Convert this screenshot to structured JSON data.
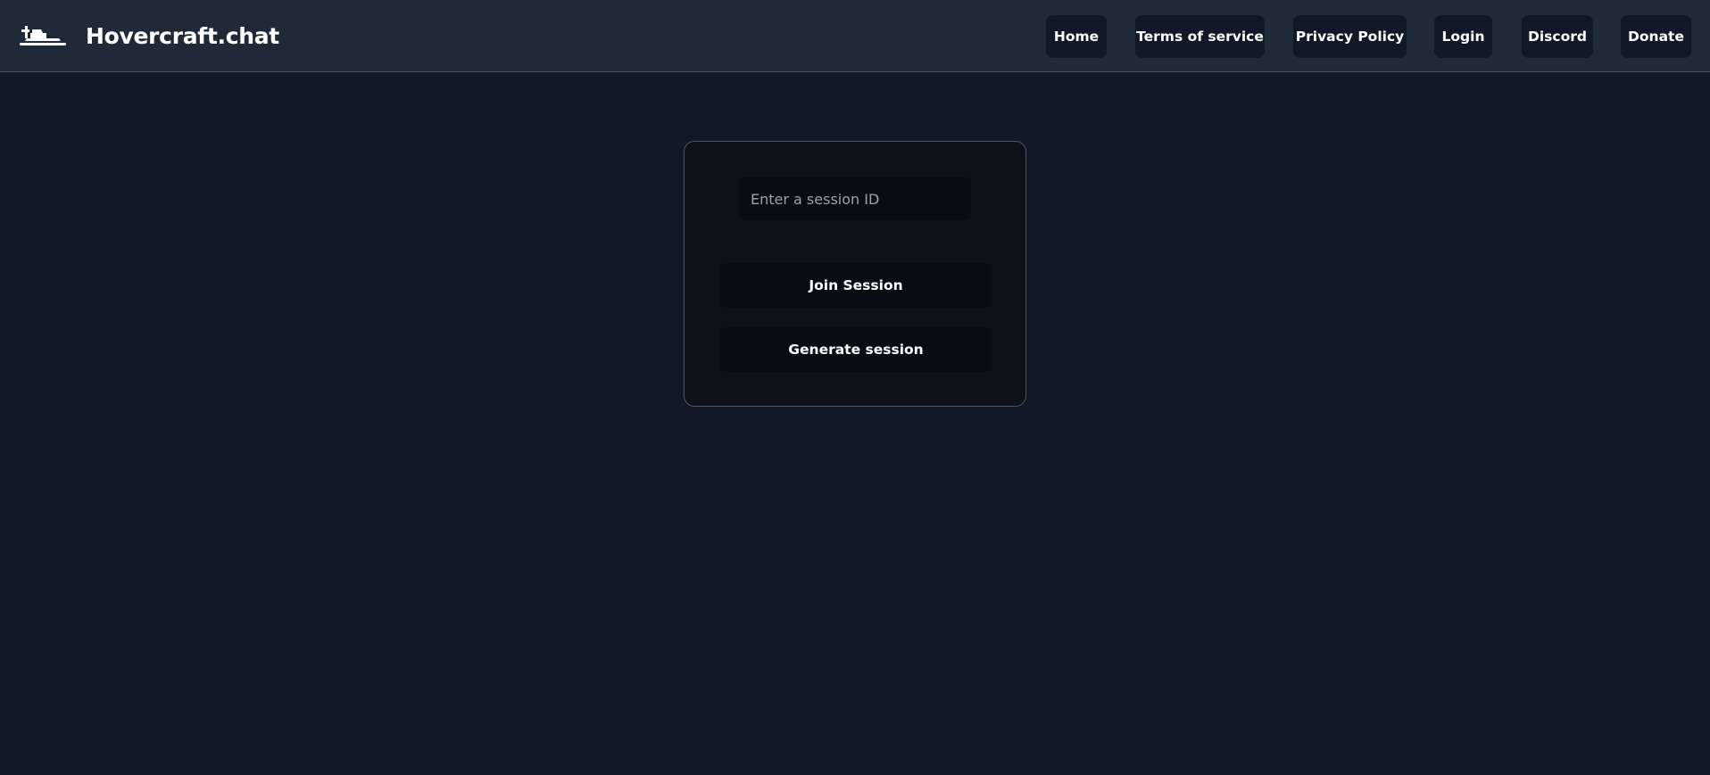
{
  "header": {
    "brand_title": "Hovercraft.chat",
    "brand_icon": "hovercraft-icon",
    "nav": [
      {
        "id": "home",
        "label": "Home"
      },
      {
        "id": "terms",
        "label": "Terms of service"
      },
      {
        "id": "privacy",
        "label": "Privacy Policy"
      },
      {
        "id": "login",
        "label": "Login"
      },
      {
        "id": "discord",
        "label": "Discord"
      },
      {
        "id": "donate",
        "label": "Donate"
      }
    ]
  },
  "session_card": {
    "input_placeholder": "Enter a session ID",
    "input_value": "",
    "join_label": "Join Session",
    "generate_label": "Generate session"
  },
  "colors": {
    "page_background": "#111827",
    "navbar_background": "#1f2937",
    "button_background": "#111827",
    "card_background": "#0c111a",
    "card_border": "#4b5563",
    "text": "#ffffff",
    "placeholder": "#9ca3af"
  }
}
